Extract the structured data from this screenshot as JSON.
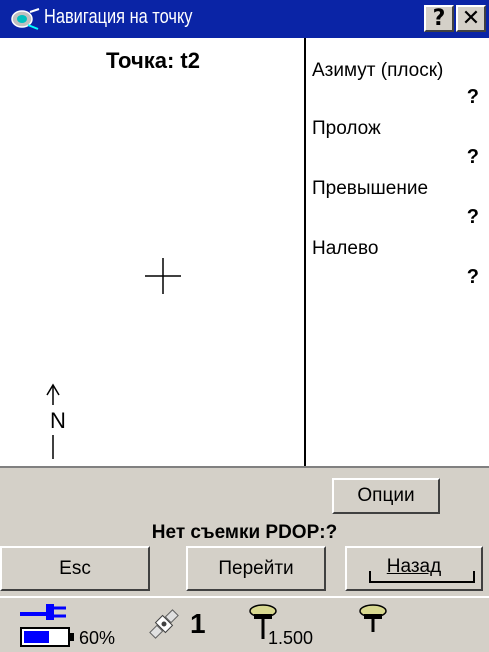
{
  "window": {
    "title": "Навигация на точку",
    "help_label": "?",
    "close_label": "✕"
  },
  "map": {
    "point_prefix": "Точка:",
    "point_name": "t2",
    "north_label": "N"
  },
  "info": [
    {
      "label": "Азимут (плоск)",
      "value": "?"
    },
    {
      "label": "Пролож",
      "value": "?"
    },
    {
      "label": "Превышение",
      "value": "?"
    },
    {
      "label": "Налево",
      "value": "?"
    }
  ],
  "toolbar": {
    "options_label": "Опции",
    "status_text": "Нет съемки  PDOP:?",
    "esc_label": "Esc",
    "go_label": "Перейти",
    "back_label": "Назад"
  },
  "statusbar": {
    "battery_percent": "60%",
    "battery_level": 0.6,
    "satellites": "1",
    "antenna_height": "1.500"
  },
  "colors": {
    "titlebar": "#0a24a6",
    "panel": "#d4d0c8",
    "power_blue": "#0000ff"
  }
}
